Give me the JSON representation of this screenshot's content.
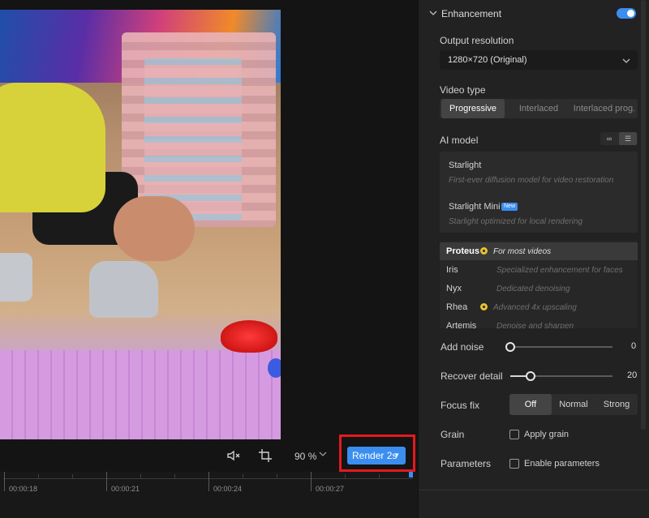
{
  "preview": {
    "zoom_value": "90",
    "zoom_unit": "%",
    "render_label": "Render 2s",
    "timeline_labels": [
      "00:00:18",
      "00:00:21",
      "00:00:24",
      "00:00:27"
    ]
  },
  "panel": {
    "section_title": "Enhancement",
    "enhancement_enabled": true,
    "output_resolution": {
      "label": "Output resolution",
      "value": "1280×720 (Original)"
    },
    "video_type": {
      "label": "Video type",
      "options": [
        "Progressive",
        "Interlaced",
        "Interlaced prog."
      ],
      "selected": "Progressive"
    },
    "ai_model": {
      "label": "AI model",
      "diffusion_models": [
        {
          "name": "Starlight",
          "description": "First-ever diffusion model for video restoration"
        },
        {
          "name": "Starlight Mini",
          "badge": "New",
          "description": "Starlight optimized for local rendering"
        }
      ],
      "models": [
        {
          "name": "Proteus",
          "starred": true,
          "description": "For most videos",
          "selected": true
        },
        {
          "name": "Iris",
          "starred": false,
          "description": "Specialized enhancement for faces"
        },
        {
          "name": "Nyx",
          "starred": false,
          "description": "Dedicated denoising"
        },
        {
          "name": "Rhea",
          "starred": true,
          "description": "Advanced 4x upscaling"
        },
        {
          "name": "Artemis",
          "starred": false,
          "description": "Denoise and sharpen"
        }
      ]
    },
    "add_noise": {
      "label": "Add noise",
      "value": "0",
      "fraction": 0.0
    },
    "recover_detail": {
      "label": "Recover detail",
      "value": "20",
      "fraction": 0.2
    },
    "focus_fix": {
      "label": "Focus fix",
      "options": [
        "Off",
        "Normal",
        "Strong"
      ],
      "selected": "Off"
    },
    "grain": {
      "label": "Grain",
      "checkbox_label": "Apply grain",
      "checked": false
    },
    "parameters": {
      "label": "Parameters",
      "checkbox_label": "Enable parameters",
      "checked": false
    }
  }
}
